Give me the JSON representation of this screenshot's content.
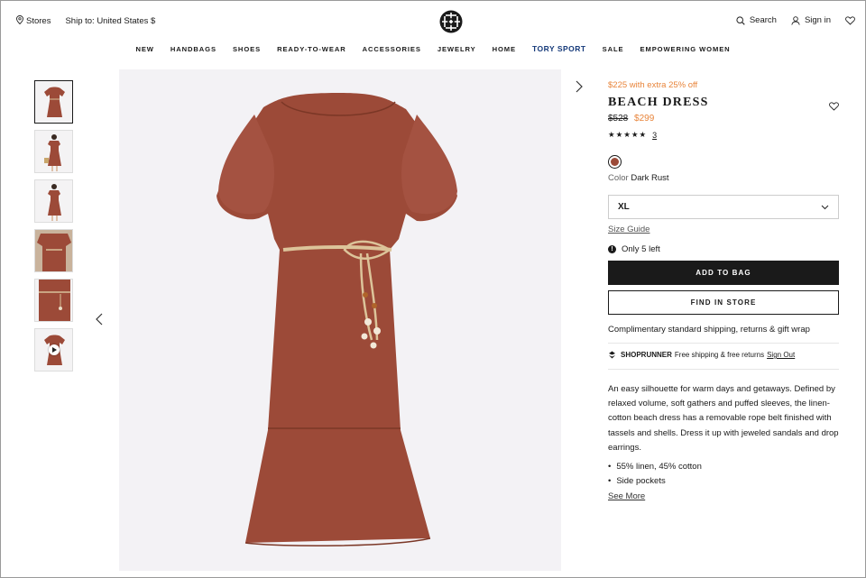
{
  "header": {
    "stores_label": "Stores",
    "ship_label": "Ship to: United States $",
    "search_label": "Search",
    "signin_label": "Sign in"
  },
  "nav": {
    "items": [
      "NEW",
      "HANDBAGS",
      "SHOES",
      "READY-TO-WEAR",
      "ACCESSORIES",
      "JEWELRY",
      "HOME",
      "TORY SPORT",
      "SALE",
      "EMPOWERING WOMEN"
    ]
  },
  "gallery": {
    "prev_arrow": "‹",
    "next_arrow": "›",
    "thumb_count": 6,
    "video_thumb_index": 5
  },
  "product": {
    "promo": "$225 with extra 25% off",
    "name": "BEACH DRESS",
    "old_price": "$528",
    "price": "$299",
    "stars": "★★★★★",
    "review_count": "3",
    "color_label": "Color",
    "color_value": "Dark Rust",
    "swatch_color": "#9c4a38",
    "size_selected": "XL",
    "size_guide": "Size Guide",
    "stock_note": "Only 5 left",
    "add_to_bag": "ADD TO BAG",
    "find_in_store": "FIND IN STORE",
    "shipping_note": "Complimentary standard shipping, returns & gift wrap",
    "shoprunner_brand": "SHOPRUNNER",
    "shoprunner_text": "Free shipping & free returns",
    "shoprunner_signout": "Sign Out",
    "description": "An easy silhouette for warm days and getaways. Defined by relaxed volume, soft gathers and puffed sleeves, the linen-cotton beach dress has a removable rope belt finished with tassels and shells. Dress it up with jeweled sandals and drop earrings.",
    "bullets": [
      "55% linen, 45% cotton",
      "Side pockets"
    ],
    "see_more": "See More"
  },
  "colors": {
    "accent_orange": "#e8843a",
    "dress": "#9c4a38",
    "nav_sport": "#163a7a",
    "button_dark": "#1a1a1a"
  }
}
